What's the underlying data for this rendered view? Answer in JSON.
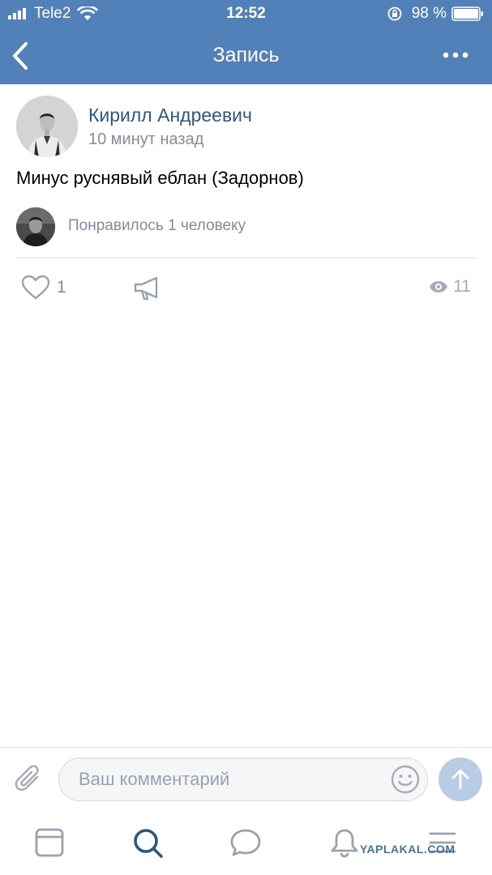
{
  "status_bar": {
    "carrier": "Tele2",
    "time": "12:52",
    "battery": "98 %"
  },
  "nav": {
    "title": "Запись"
  },
  "post": {
    "author_name": "Кирилл Андреевич",
    "time_ago": "10 минут назад",
    "text": "Минус руснявый еблан (Задорнов)",
    "likes_text": "Понравилось 1 человеку",
    "like_count": "1",
    "views_count": "11"
  },
  "comment": {
    "placeholder": "Ваш комментарий"
  },
  "watermark": "YAPLAKAL.COM",
  "colors": {
    "header": "#5181b8",
    "link": "#2a5885",
    "secondary_text": "#818c99",
    "icon": "#99a2ad",
    "tab_active": "#2a5885"
  }
}
